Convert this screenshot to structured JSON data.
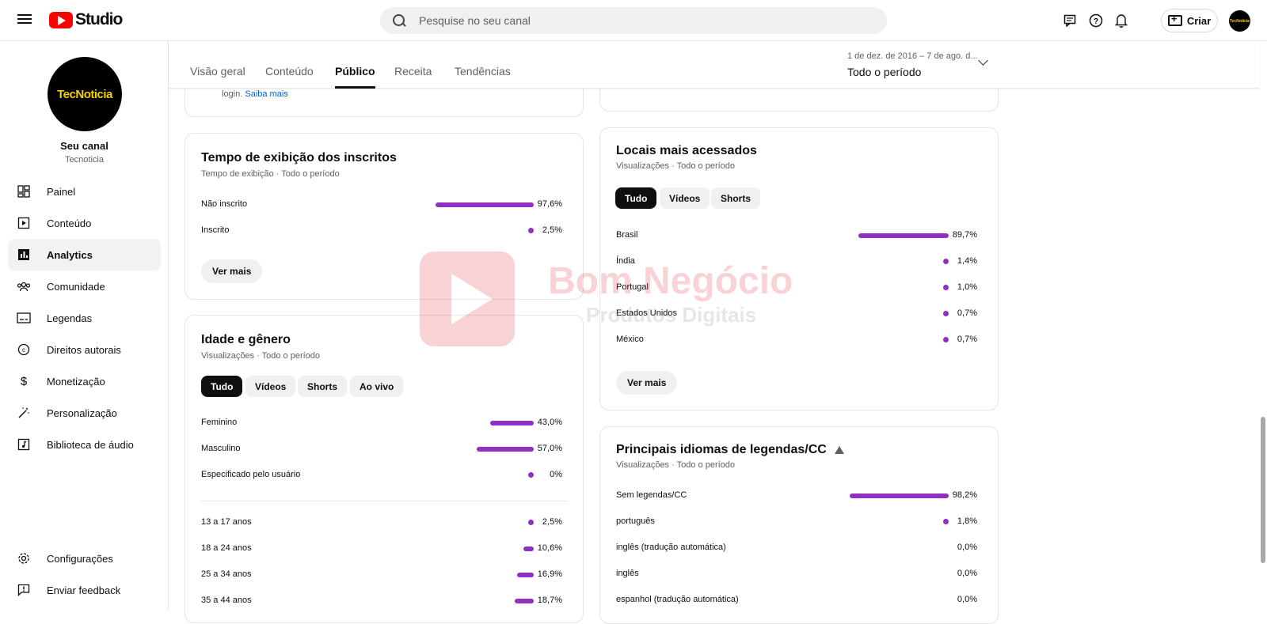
{
  "header": {
    "logo_text": "Studio",
    "search_placeholder": "Pesquise no seu canal",
    "create_label": "Criar",
    "avatar_text": "TecNoticia"
  },
  "sidebar": {
    "channel_avatar_text": "TecNoticia",
    "channel_title": "Seu canal",
    "channel_name": "Tecnoticia",
    "items": [
      {
        "label": "Painel",
        "icon": "dashboard-icon"
      },
      {
        "label": "Conteúdo",
        "icon": "content-icon"
      },
      {
        "label": "Analytics",
        "icon": "analytics-icon",
        "active": true
      },
      {
        "label": "Comunidade",
        "icon": "community-icon"
      },
      {
        "label": "Legendas",
        "icon": "subtitles-icon"
      },
      {
        "label": "Direitos autorais",
        "icon": "copyright-icon"
      },
      {
        "label": "Monetização",
        "icon": "dollar-icon"
      },
      {
        "label": "Personalização",
        "icon": "magic-wand-icon"
      },
      {
        "label": "Biblioteca de áudio",
        "icon": "audio-library-icon"
      }
    ],
    "bottom_items": [
      {
        "label": "Configurações",
        "icon": "gear-icon"
      },
      {
        "label": "Enviar feedback",
        "icon": "feedback-icon"
      }
    ]
  },
  "tabs": [
    "Visão geral",
    "Conteúdo",
    "Público",
    "Receita",
    "Tendências"
  ],
  "active_tab": "Público",
  "date_range": {
    "sub": "1 de dez. de 2016 – 7 de ago. d...",
    "main": "Todo o período"
  },
  "top_card": {
    "text": "login.",
    "link": "Saiba mais"
  },
  "subscribers_card": {
    "title": "Tempo de exibição dos inscritos",
    "subtitle": "Tempo de exibição · Todo o período",
    "rows": [
      {
        "label": "Não inscrito",
        "value": "97,6%",
        "fraction": 0.976
      },
      {
        "label": "Inscrito",
        "value": "2,5%",
        "fraction": 0.025
      }
    ],
    "more": "Ver mais"
  },
  "age_gender_card": {
    "title": "Idade e gênero",
    "subtitle": "Visualizações · Todo o período",
    "chips": [
      "Tudo",
      "Vídeos",
      "Shorts",
      "Ao vivo"
    ],
    "gender_rows": [
      {
        "label": "Feminino",
        "value": "43,0%",
        "fraction": 0.43
      },
      {
        "label": "Masculino",
        "value": "57,0%",
        "fraction": 0.57
      },
      {
        "label": "Especificado pelo usuário",
        "value": "0%",
        "fraction": 0.0
      }
    ],
    "age_rows": [
      {
        "label": "13 a 17 anos",
        "value": "2,5%",
        "fraction": 0.025
      },
      {
        "label": "18 a 24 anos",
        "value": "10,6%",
        "fraction": 0.106
      },
      {
        "label": "25 a 34 anos",
        "value": "16,9%",
        "fraction": 0.169
      },
      {
        "label": "35 a 44 anos",
        "value": "18,7%",
        "fraction": 0.187
      }
    ]
  },
  "locations_card": {
    "title": "Locais mais acessados",
    "subtitle": "Visualizações · Todo o período",
    "chips": [
      "Tudo",
      "Vídeos",
      "Shorts"
    ],
    "rows": [
      {
        "label": "Brasil",
        "value": "89,7%",
        "fraction": 0.897
      },
      {
        "label": "Índia",
        "value": "1,4%",
        "fraction": 0.014
      },
      {
        "label": "Portugal",
        "value": "1,0%",
        "fraction": 0.01
      },
      {
        "label": "Estados Unidos",
        "value": "0,7%",
        "fraction": 0.007
      },
      {
        "label": "México",
        "value": "0,7%",
        "fraction": 0.007
      }
    ],
    "more": "Ver mais"
  },
  "languages_card": {
    "title": "Principais idiomas de legendas/CC",
    "subtitle": "Visualizações · Todo o período",
    "rows": [
      {
        "label": "Sem legendas/CC",
        "value": "98,2%",
        "fraction": 0.982
      },
      {
        "label": "português",
        "value": "1,8%",
        "fraction": 0.018
      },
      {
        "label": "inglês (tradução automática)",
        "value": "0,0%",
        "fraction": 0.0
      },
      {
        "label": "inglês",
        "value": "0,0%",
        "fraction": 0.0
      },
      {
        "label": "espanhol (tradução automática)",
        "value": "0,0%",
        "fraction": 0.0
      }
    ]
  },
  "watermark": {
    "text": "Bom Negócio",
    "sub": "Produtos Digitais"
  },
  "colors": {
    "bar": "#9030c0",
    "brand": "#ff0000"
  }
}
